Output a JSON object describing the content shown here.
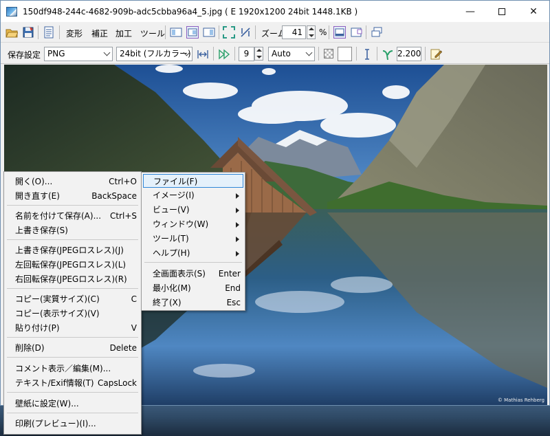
{
  "window": {
    "title": "150df948-244c-4682-909b-adc5cbba96a4_5.jpg  ( E  1920x1200  24bit  1448.1KB )",
    "minimize_glyph": "—",
    "close_glyph": "✕"
  },
  "toolbar": {
    "menus": [
      "変形",
      "補正",
      "加工",
      "ツール"
    ],
    "zoom_label": "ズーム:",
    "zoom_value": "41",
    "zoom_unit": "%"
  },
  "save_bar": {
    "label": "保存設定",
    "format": "PNG",
    "depth": "24bit (フルカラー)",
    "interval": "9",
    "mode": "Auto",
    "gamma": "2.200"
  },
  "image": {
    "credit": "© Mathias Rehberg"
  },
  "context_menu": {
    "items": [
      {
        "label": "開く(O)...",
        "shortcut": "Ctrl+O"
      },
      {
        "label": "開き直す(E)",
        "shortcut": "BackSpace"
      },
      {
        "label": "名前を付けて保存(A)...",
        "shortcut": "Ctrl+S"
      },
      {
        "label": "上書き保存(S)",
        "shortcut": ""
      },
      {
        "label": "上書き保存(JPEGロスレス)(J)",
        "shortcut": ""
      },
      {
        "label": "左回転保存(JPEGロスレス)(L)",
        "shortcut": ""
      },
      {
        "label": "右回転保存(JPEGロスレス)(R)",
        "shortcut": ""
      },
      {
        "label": "コピー(実質サイズ)(C)",
        "shortcut": "C"
      },
      {
        "label": "コピー(表示サイズ)(V)",
        "shortcut": ""
      },
      {
        "label": "貼り付け(P)",
        "shortcut": "V"
      },
      {
        "label": "削除(D)",
        "shortcut": "Delete"
      },
      {
        "label": "コメント表示／編集(M)...",
        "shortcut": ""
      },
      {
        "label": "テキスト/Exif情報(T)",
        "shortcut": "CapsLock"
      },
      {
        "label": "壁紙に設定(W)...",
        "shortcut": ""
      },
      {
        "label": "印刷(プレビュー)(I)...",
        "shortcut": ""
      }
    ]
  },
  "submenu": {
    "items": [
      {
        "label": "ファイル(F)",
        "shortcut": ""
      },
      {
        "label": "イメージ(I)",
        "shortcut": ""
      },
      {
        "label": "ビュー(V)",
        "shortcut": ""
      },
      {
        "label": "ウィンドウ(W)",
        "shortcut": ""
      },
      {
        "label": "ツール(T)",
        "shortcut": ""
      },
      {
        "label": "ヘルプ(H)",
        "shortcut": ""
      },
      {
        "label": "全画面表示(S)",
        "shortcut": "Enter"
      },
      {
        "label": "最小化(M)",
        "shortcut": "End"
      },
      {
        "label": "終了(X)",
        "shortcut": "Esc"
      }
    ]
  }
}
